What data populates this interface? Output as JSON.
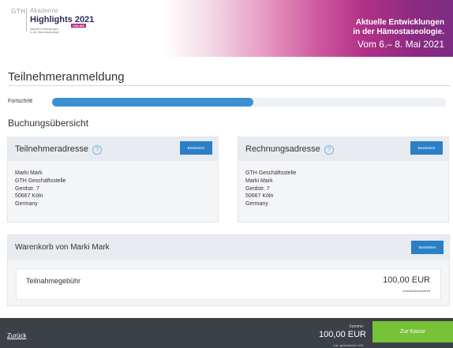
{
  "banner": {
    "logo": {
      "gth": "GTH",
      "akademie": "Akademie",
      "title": "Highlights 2021",
      "badge": "ONLINE",
      "sub1": "Aktuelle Entwicklungen",
      "sub2": "in der Hämostaseologie"
    },
    "line1": "Aktuelle Entwicklungen",
    "line2": "in der Hämostaseologie.",
    "line3": "Vom 6.– 8. Mai 2021",
    "gradient_colors": [
      "#ffffff",
      "#e79cc3",
      "#b23187",
      "#7c2d83"
    ]
  },
  "page": {
    "title": "Teilnehmeranmeldung"
  },
  "progress": {
    "label": "Fortschritt",
    "percent": 51,
    "color": "#3b8fd3"
  },
  "section": {
    "title": "Buchungsübersicht"
  },
  "participant_card": {
    "title": "Teilnehmeradresse",
    "help_icon": "question-circle-icon",
    "edit_label": "Bearbeiten",
    "lines": [
      "Marki Mark",
      "GTH Geschäftsstelle",
      "Gerdstr. 7",
      "50667 Köln",
      "Germany"
    ]
  },
  "billing_card": {
    "title": "Rechnungsadresse",
    "help_icon": "question-circle-icon",
    "edit_label": "Bearbeiten",
    "lines": [
      "GTH Geschäftsstelle",
      "Marki Mark",
      "Gerdstr. 7",
      "50667 Köln",
      "Germany"
    ]
  },
  "cart": {
    "title": "Warenkorb von Marki Mark",
    "edit_label": "Bearbeiten",
    "item": {
      "name": "Teilnahmegebühr",
      "price": "100,00 EUR",
      "note": "umsatzsteuerbefreit"
    }
  },
  "footer": {
    "back_label": "Zurück",
    "sum_label": "Summe:",
    "sum_value": "100,00 EUR",
    "sum_note": "inkl. gesetzlicher USt.",
    "checkout_label": "Zur Kasse"
  },
  "colors": {
    "accent_blue": "#2a7fc7",
    "checkout_green": "#78c238",
    "footer_dark": "#3c4047"
  }
}
